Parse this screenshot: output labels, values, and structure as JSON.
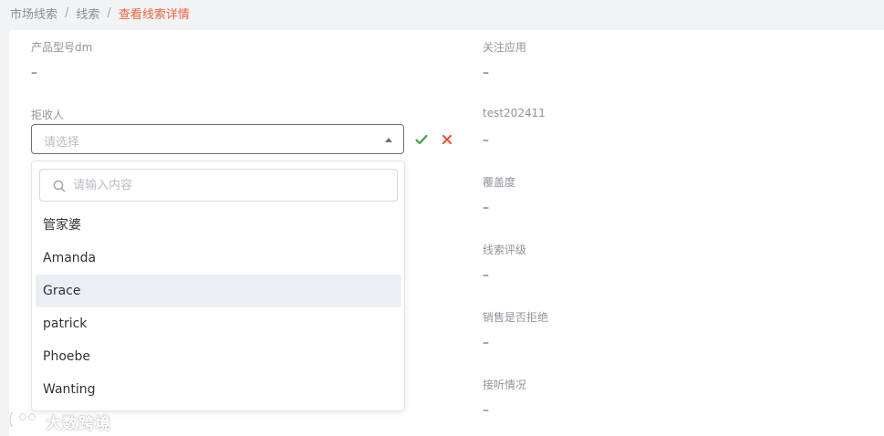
{
  "breadcrumb": {
    "items": [
      "市场线索",
      "线索"
    ],
    "separator": "/",
    "current": "查看线索详情"
  },
  "left_fields": {
    "product_model": {
      "label": "产品型号dm",
      "value": "–"
    },
    "rejector": {
      "label": "拒收人",
      "placeholder": "请选择"
    }
  },
  "right_fields": [
    {
      "label": "关注应用",
      "value": "–"
    },
    {
      "label": "test202411",
      "value": "–"
    },
    {
      "label": "覆盖度",
      "value": "–"
    },
    {
      "label": "线索评级",
      "value": "–"
    },
    {
      "label": "销售是否拒绝",
      "value": "–"
    },
    {
      "label": "接听情况",
      "value": "–"
    }
  ],
  "actions": {
    "confirm_icon": "check-icon",
    "cancel_icon": "close-icon",
    "confirm_color": "#43a047",
    "cancel_color": "#e8533a"
  },
  "dropdown": {
    "search_placeholder": "请输入内容",
    "options": [
      "管家婆",
      "Amanda",
      "Grace",
      "patrick",
      "Phoebe",
      "Wanting"
    ],
    "highlighted": "Grace"
  },
  "watermark": {
    "text": "大数跨境"
  },
  "colors": {
    "accent": "#f0633c",
    "highlight_bg": "#ebeff5"
  }
}
